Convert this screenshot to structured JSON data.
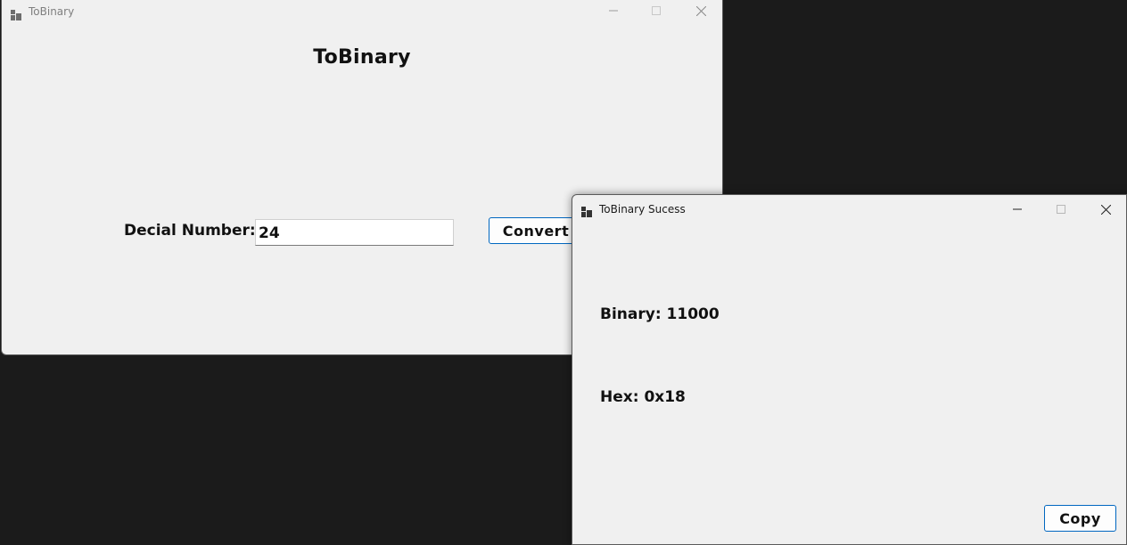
{
  "main_window": {
    "title": "ToBinary",
    "heading": "ToBinary",
    "decimal_label": "Decial Number:",
    "decimal_value": "24",
    "convert_label": "Convert"
  },
  "popup_window": {
    "title": "ToBinary Sucess",
    "binary_text": "Binary: 11000",
    "hex_text": "Hex: 0x18",
    "copy_label": "Copy"
  },
  "icons": {
    "app": "app-icon",
    "minimize": "minimize-icon",
    "maximize": "maximize-icon",
    "close": "close-icon"
  },
  "colors": {
    "desktop": "#1b1b1b",
    "window": "#f0f0f0",
    "button_border": "#0067c0"
  }
}
